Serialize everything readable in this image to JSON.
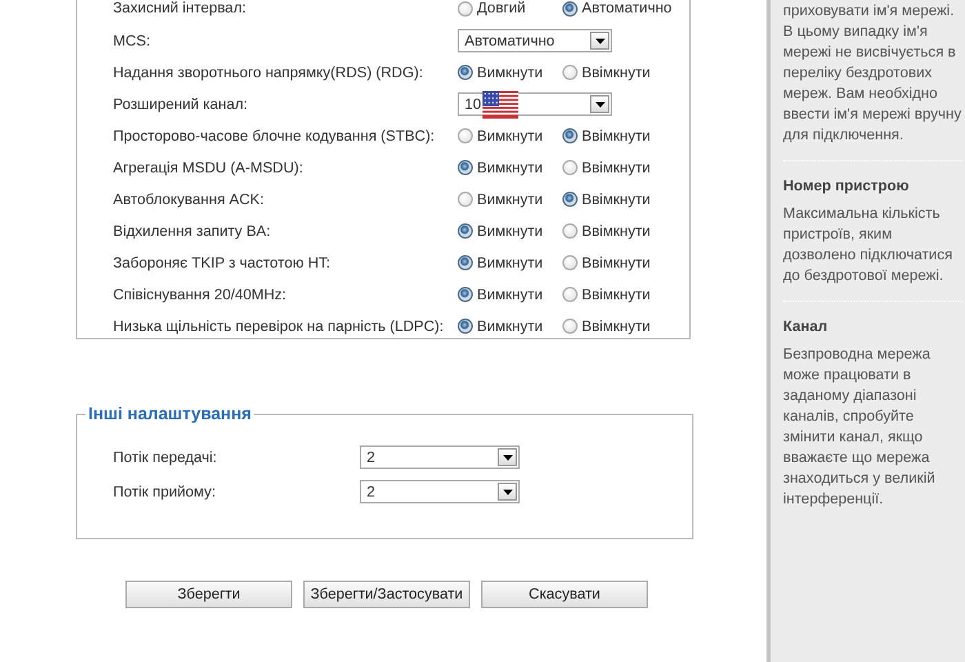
{
  "advanced_settings": {
    "rows": [
      {
        "label": "Захисний інтервал:",
        "kind": "radio",
        "options": [
          {
            "label": "Довгий",
            "selected": false
          },
          {
            "label": "Автоматично",
            "selected": true
          }
        ]
      },
      {
        "label": "MCS:",
        "kind": "select",
        "value": "Автоматично",
        "flag_icon": false
      },
      {
        "label": "Надання зворотнього напрямку(RDS) (RDG):",
        "kind": "radio",
        "options": [
          {
            "label": "Вимкнути",
            "selected": true
          },
          {
            "label": "Ввімкнути",
            "selected": false
          }
        ]
      },
      {
        "label": "Розширений канал:",
        "kind": "select",
        "value": "10",
        "flag_icon": true
      },
      {
        "label": "Просторово-часове блочне кодування (STBC):",
        "kind": "radio",
        "options": [
          {
            "label": "Вимкнути",
            "selected": false
          },
          {
            "label": "Ввімкнути",
            "selected": true
          }
        ]
      },
      {
        "label": "Агрегація MSDU (A-MSDU):",
        "kind": "radio",
        "options": [
          {
            "label": "Вимкнути",
            "selected": true
          },
          {
            "label": "Ввімкнути",
            "selected": false
          }
        ]
      },
      {
        "label": "Автоблокування ACK:",
        "kind": "radio",
        "options": [
          {
            "label": "Вимкнути",
            "selected": false
          },
          {
            "label": "Ввімкнути",
            "selected": true
          }
        ]
      },
      {
        "label": "Відхилення запиту BA:",
        "kind": "radio",
        "options": [
          {
            "label": "Вимкнути",
            "selected": true
          },
          {
            "label": "Ввімкнути",
            "selected": false
          }
        ]
      },
      {
        "label": "Забороняє TKIP з частотою HT:",
        "kind": "radio",
        "options": [
          {
            "label": "Вимкнути",
            "selected": true
          },
          {
            "label": "Ввімкнути",
            "selected": false
          }
        ]
      },
      {
        "label": "Співіснування 20/40MHz:",
        "kind": "radio",
        "options": [
          {
            "label": "Вимкнути",
            "selected": true
          },
          {
            "label": "Ввімкнути",
            "selected": false
          }
        ]
      },
      {
        "label": "Низька щільність перевірок на парність (LDPC):",
        "kind": "radio",
        "options": [
          {
            "label": "Вимкнути",
            "selected": true
          },
          {
            "label": "Ввімкнути",
            "selected": false
          }
        ]
      }
    ]
  },
  "other_settings": {
    "title": "Інші налаштування",
    "rows": [
      {
        "label": "Потік передачі:",
        "value": "2"
      },
      {
        "label": "Потік прийому:",
        "value": "2"
      }
    ]
  },
  "buttons": [
    "Зберегти",
    "Зберегти/Застосувати",
    "Скасувати"
  ],
  "help": [
    {
      "text": "приховувати ім'я мережі. В цьому випадку ім'я мережі не висвічується в переліку бездротових мереж. Вам необхідно ввести ім'я мережі вручну для підключення."
    },
    {
      "heading": "Номер пристрою",
      "text": "Максимальна кількість пристроїв, яким дозволено підключатися до бездротової мережі."
    },
    {
      "heading": "Канал",
      "text": "Безпроводна мережа може працювати в заданому діапазоні каналів, спробуйте змінити канал, якщо вважаєте що мережа знаходиться у великій інтерференції."
    }
  ]
}
